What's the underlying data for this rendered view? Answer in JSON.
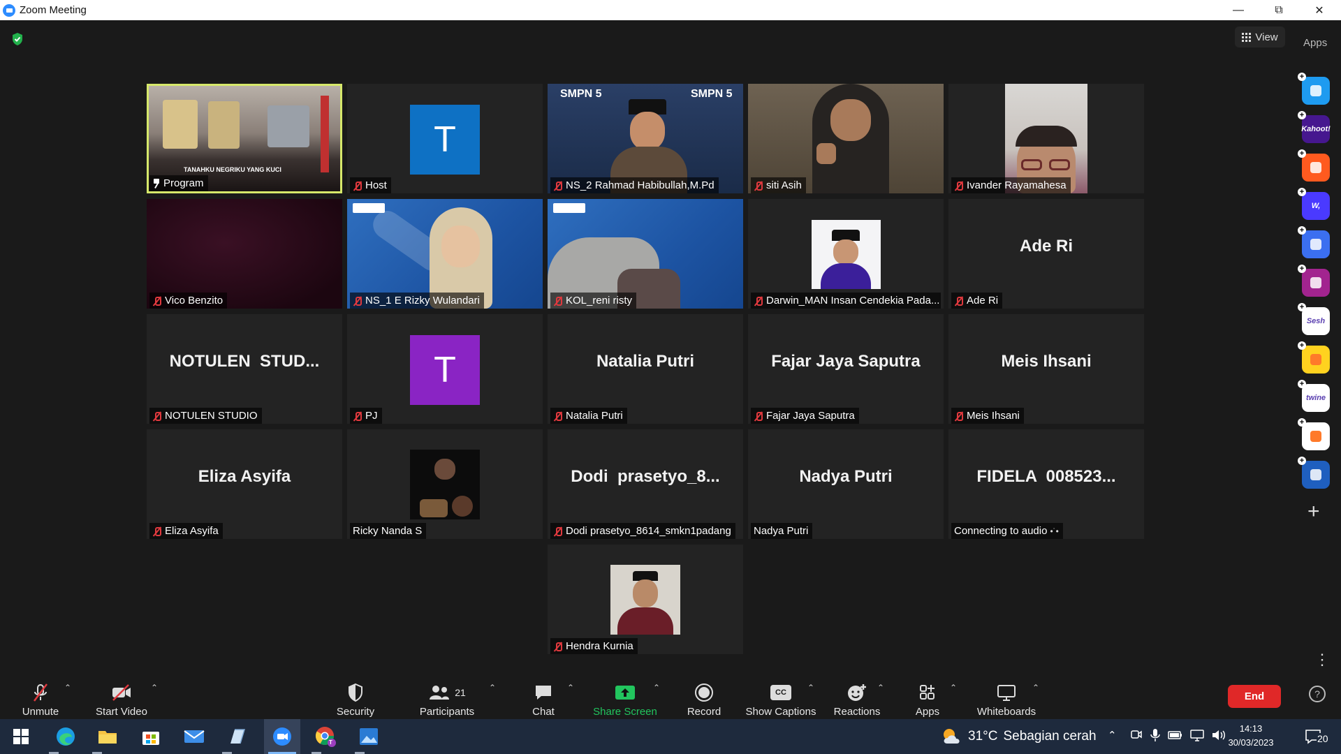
{
  "window": {
    "title": "Zoom Meeting"
  },
  "topbar": {
    "view_label": "View",
    "apps_label": "Apps"
  },
  "tiles": [
    {
      "display": "",
      "label": "Program",
      "muted": false,
      "pinned": true
    },
    {
      "display": "",
      "label": "Host",
      "muted": true,
      "avatar_letter": "T",
      "avatar_color": "#0e71c4"
    },
    {
      "display": "",
      "label": "NS_2 Rahmad Habibullah,M.Pd",
      "muted": true,
      "video_text": "SMPN 5"
    },
    {
      "display": "",
      "label": "siti Asih",
      "muted": true
    },
    {
      "display": "",
      "label": "Ivander Rayamahesa",
      "muted": true
    },
    {
      "display": "",
      "label": "Vico Benzito",
      "muted": true
    },
    {
      "display": "",
      "label": "NS_1 E Rizky Wulandari",
      "muted": true
    },
    {
      "display": "",
      "label": "KOL_reni risty",
      "muted": true
    },
    {
      "display": "",
      "label": "Darwin_MAN Insan Cendekia Pada...",
      "muted": true
    },
    {
      "display": "Ade Ri",
      "label": "Ade Ri",
      "muted": true
    },
    {
      "display": "NOTULEN  STUD...",
      "label": "NOTULEN STUDIO",
      "muted": true
    },
    {
      "display": "",
      "label": "PJ",
      "muted": true,
      "avatar_letter": "T",
      "avatar_color": "#8a24c4"
    },
    {
      "display": "Natalia Putri",
      "label": "Natalia Putri",
      "muted": true
    },
    {
      "display": "Fajar Jaya Saputra",
      "label": "Fajar Jaya Saputra",
      "muted": true
    },
    {
      "display": "Meis Ihsani",
      "label": "Meis Ihsani",
      "muted": true
    },
    {
      "display": "Eliza Asyifa",
      "label": "Eliza Asyifa",
      "muted": true
    },
    {
      "display": "",
      "label": "Ricky Nanda S",
      "muted": false
    },
    {
      "display": "Dodi  prasetyo_8...",
      "label": "Dodi prasetyo_8614_smkn1padang",
      "muted": true
    },
    {
      "display": "Nadya Putri",
      "label": "Nadya Putri",
      "muted": false
    },
    {
      "display": "FIDELA  008523...",
      "label": "Connecting to audio",
      "muted": false
    },
    {
      "display": "",
      "label": "Hendra Kurnia",
      "muted": true
    }
  ],
  "video_captions": {
    "program_banner": "TANAHKU NEGRIKU YANG KUCI"
  },
  "rail_apps": [
    {
      "icon": "prezi-icon",
      "text": "",
      "color": "#1e9bf0"
    },
    {
      "icon": "kahoot-icon",
      "text": "Kahoot!",
      "color": "#46178f"
    },
    {
      "icon": "orange-app-icon",
      "text": "",
      "color": "#ff5a1f"
    },
    {
      "icon": "wordwall-icon",
      "text": "W,",
      "color": "#4a3aff"
    },
    {
      "icon": "ai-app-icon",
      "text": "",
      "color": "#3b6ff0"
    },
    {
      "icon": "video-app-icon",
      "text": "",
      "color": "#a2248f"
    },
    {
      "icon": "sesh-icon",
      "text": "Sesh",
      "color": "#ffffff"
    },
    {
      "icon": "emoji-app-icon",
      "text": "",
      "color": "#ffd21f"
    },
    {
      "icon": "twine-icon",
      "text": "twine",
      "color": "#ffffff"
    },
    {
      "icon": "blocks-app-icon",
      "text": "",
      "color": "#ffffff"
    },
    {
      "icon": "sync-app-icon",
      "text": "",
      "color": "#1f5fbf"
    }
  ],
  "toolbar": {
    "unmute": "Unmute",
    "start_video": "Start Video",
    "security": "Security",
    "participants": "Participants",
    "participants_count": "21",
    "chat": "Chat",
    "share_screen": "Share Screen",
    "record": "Record",
    "show_captions": "Show Captions",
    "captions_badge": "CC",
    "reactions": "Reactions",
    "apps": "Apps",
    "whiteboards": "Whiteboards",
    "end": "End",
    "help": "?"
  },
  "colors": {
    "share_green": "#22c55e",
    "end_red": "#e02828",
    "active_border": "#d6e86a"
  },
  "taskbar": {
    "weather_temp": "31°C",
    "weather_desc": "Sebagian cerah",
    "time": "14:13",
    "date": "30/03/2023",
    "notification_count": "20",
    "chrome_badge": "T"
  }
}
